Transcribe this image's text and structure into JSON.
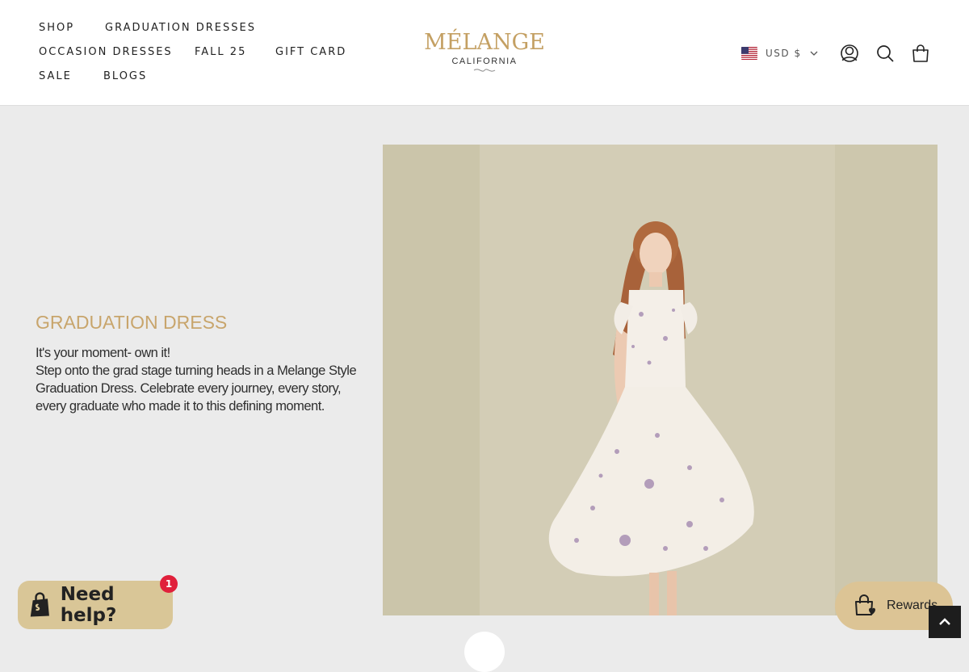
{
  "nav": {
    "shop": "SHOP",
    "graduation_dresses": "GRADUATION DRESSES",
    "occasion_dresses": "OCCASION DRESSES",
    "fall_25": "FALL 25",
    "gift_card": "GIFT CARD",
    "sale": "SALE",
    "blogs": "BLOGS"
  },
  "logo": {
    "main": "MÉLANGE",
    "sub": "CALIFORNIA"
  },
  "currency": {
    "label": "USD $",
    "flag": "us-flag-icon"
  },
  "icons": [
    "account-icon",
    "search-icon",
    "bag-icon"
  ],
  "hero": {
    "title": "GRADUATION DRESS",
    "line1": "It's your moment- own it!",
    "line2": "Step onto the grad stage turning heads in a Melange Style Graduation Dress. Celebrate every journey, every story, every graduate who made it to this defining moment."
  },
  "help_widget": {
    "label": "Need help?",
    "badge": "1"
  },
  "rewards_widget": {
    "label": "Rewards"
  },
  "colors": {
    "brand_gold": "#c4a063",
    "widget_tan": "#d9c697",
    "badge_red": "#e0203b"
  }
}
